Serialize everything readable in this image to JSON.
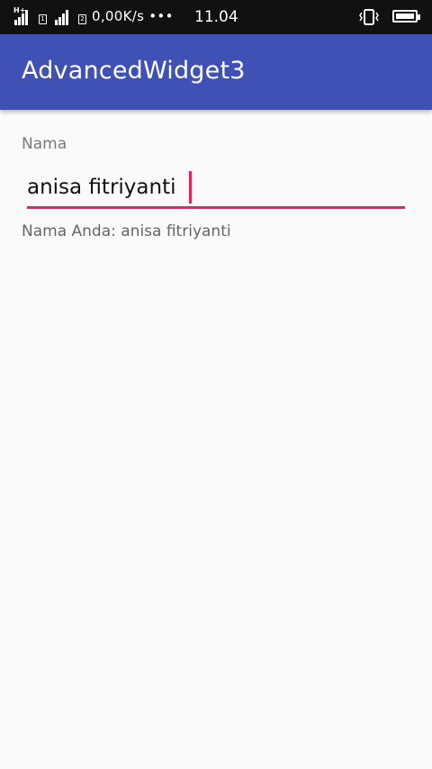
{
  "status_bar": {
    "network_badge": "H+",
    "sim1": "1",
    "sim2": "2",
    "speed": "0,00K/s •••",
    "time": "11.04"
  },
  "app_bar": {
    "title": "AdvancedWidget3"
  },
  "form": {
    "label": "Nama",
    "input_value": "anisa fitriyanti",
    "result": "Nama Anda: anisa fitriyanti"
  },
  "colors": {
    "status_bar_bg": "#111111",
    "app_bar_bg": "#3f51b5",
    "accent": "#e91e63",
    "page_bg": "#fafafa"
  },
  "icons": [
    "signal-icon",
    "sim-icon",
    "vibrate-icon",
    "battery-icon"
  ]
}
